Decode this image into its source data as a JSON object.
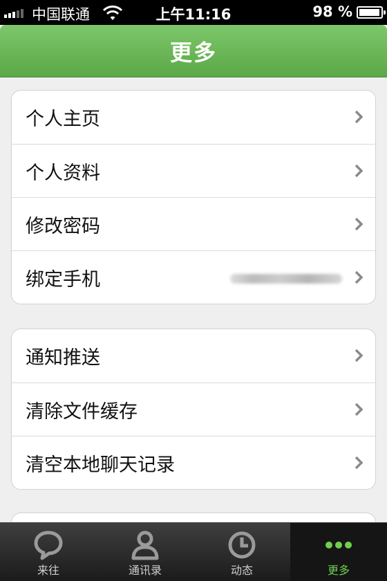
{
  "status_bar": {
    "carrier": "中国联通",
    "time": "上午11:16",
    "battery_percent": "98 %",
    "battery_level": 0.98,
    "signal_bars_on": 3,
    "signal_bars_total": 5
  },
  "header": {
    "title": "更多"
  },
  "menu_groups": [
    {
      "items": [
        {
          "label": "个人主页"
        },
        {
          "label": "个人资料"
        },
        {
          "label": "修改密码"
        },
        {
          "label": "绑定手机"
        }
      ]
    },
    {
      "items": [
        {
          "label": "通知推送"
        },
        {
          "label": "清除文件缓存"
        },
        {
          "label": "清空本地聊天记录"
        }
      ]
    }
  ],
  "tabs": [
    {
      "label": "来往",
      "icon": "chat-bubble-icon",
      "active": false
    },
    {
      "label": "通讯录",
      "icon": "person-icon",
      "active": false
    },
    {
      "label": "动态",
      "icon": "clock-icon",
      "active": false
    },
    {
      "label": "更多",
      "icon": "more-dots-icon",
      "active": true
    }
  ],
  "colors": {
    "header_green": "#6ab955",
    "active_tab": "#6fcf4e",
    "tab_bar": "#2a2a2a"
  }
}
